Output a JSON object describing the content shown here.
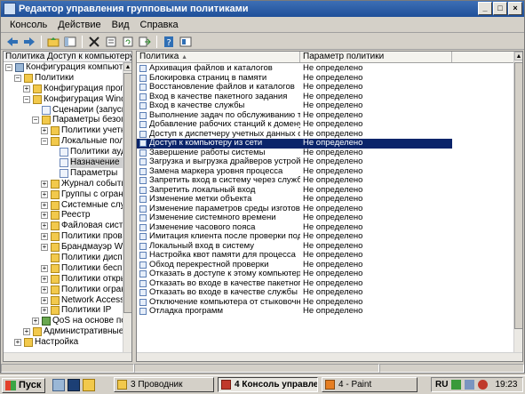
{
  "window": {
    "title": "Редактор управления групповыми политиками",
    "controls": [
      "_",
      "□",
      "×"
    ]
  },
  "menu": [
    "Консоль",
    "Действие",
    "Вид",
    "Справка"
  ],
  "toolbar": [
    "back-arrow-icon",
    "forward-arrow-icon",
    "up-folder-icon",
    "show-hide-tree-icon",
    "delete-icon",
    "properties-icon",
    "refresh-icon",
    "export-icon",
    "help-icon",
    "help-topic-icon"
  ],
  "tree": {
    "header": "Политика Доступ к компьютеру",
    "items": [
      {
        "depth": 0,
        "expander": "−",
        "icon": "pc",
        "label": "Конфигурация компьютера"
      },
      {
        "depth": 1,
        "expander": "−",
        "icon": "folder",
        "label": "Политики"
      },
      {
        "depth": 2,
        "expander": "+",
        "icon": "folder",
        "label": "Конфигурация программ"
      },
      {
        "depth": 2,
        "expander": "−",
        "icon": "folder",
        "label": "Конфигурация Windows"
      },
      {
        "depth": 3,
        "expander": "",
        "icon": "doc",
        "label": "Сценарии (запуск)"
      },
      {
        "depth": 3,
        "expander": "−",
        "icon": "folder",
        "label": "Параметры безопасности"
      },
      {
        "depth": 4,
        "expander": "+",
        "icon": "folder",
        "label": "Политики учетных"
      },
      {
        "depth": 4,
        "expander": "−",
        "icon": "folder",
        "label": "Локальные политики"
      },
      {
        "depth": 5,
        "expander": "",
        "icon": "doc",
        "label": "Политики аудита"
      },
      {
        "depth": 5,
        "expander": "",
        "icon": "doc",
        "label": "Назначение прав",
        "selected": true
      },
      {
        "depth": 5,
        "expander": "",
        "icon": "doc",
        "label": "Параметры"
      },
      {
        "depth": 4,
        "expander": "+",
        "icon": "folder",
        "label": "Журнал событий"
      },
      {
        "depth": 4,
        "expander": "+",
        "icon": "folder",
        "label": "Группы с ограниченным"
      },
      {
        "depth": 4,
        "expander": "+",
        "icon": "folder",
        "label": "Системные службы"
      },
      {
        "depth": 4,
        "expander": "+",
        "icon": "folder",
        "label": "Реестр"
      },
      {
        "depth": 4,
        "expander": "+",
        "icon": "folder",
        "label": "Файловая система"
      },
      {
        "depth": 4,
        "expander": "+",
        "icon": "folder",
        "label": "Политики проводной"
      },
      {
        "depth": 4,
        "expander": "+",
        "icon": "folder",
        "label": "Брандмауэр Windows"
      },
      {
        "depth": 4,
        "expander": "",
        "icon": "folder",
        "label": "Политики диспетчера"
      },
      {
        "depth": 4,
        "expander": "+",
        "icon": "folder",
        "label": "Политики беспроводной"
      },
      {
        "depth": 4,
        "expander": "+",
        "icon": "folder",
        "label": "Политики открытого"
      },
      {
        "depth": 4,
        "expander": "+",
        "icon": "folder",
        "label": "Политики ограниченного"
      },
      {
        "depth": 4,
        "expander": "+",
        "icon": "folder",
        "label": "Network Access"
      },
      {
        "depth": 4,
        "expander": "+",
        "icon": "folder",
        "label": "Политики IP"
      },
      {
        "depth": 3,
        "expander": "+",
        "icon": "chart",
        "label": "QoS на основе политики"
      },
      {
        "depth": 2,
        "expander": "+",
        "icon": "folder",
        "label": "Административные шаблоны"
      },
      {
        "depth": 1,
        "expander": "+",
        "icon": "folder",
        "label": "Настройка"
      }
    ]
  },
  "list": {
    "columns": [
      "Политика",
      "Параметр политики"
    ],
    "rows": [
      {
        "policy": "Архивация файлов и каталогов",
        "value": "Не определено"
      },
      {
        "policy": "Блокировка страниц в памяти",
        "value": "Не определено"
      },
      {
        "policy": "Восстановление файлов и каталогов",
        "value": "Не определено"
      },
      {
        "policy": "Вход в качестве пакетного задания",
        "value": "Не определено"
      },
      {
        "policy": "Вход в качестве службы",
        "value": "Не определено"
      },
      {
        "policy": "Выполнение задач по обслуживанию томов",
        "value": "Не определено"
      },
      {
        "policy": "Добавление рабочих станций к домену",
        "value": "Не определено"
      },
      {
        "policy": "Доступ к диспетчеру учетных данных от...",
        "value": "Не определено"
      },
      {
        "policy": "Доступ к компьютеру из сети",
        "value": "Не определено",
        "selected": true
      },
      {
        "policy": "Завершение работы системы",
        "value": "Не определено"
      },
      {
        "policy": "Загрузка и выгрузка драйверов устройств",
        "value": "Не определено"
      },
      {
        "policy": "Замена маркера уровня процесса",
        "value": "Не определено"
      },
      {
        "policy": "Запретить вход в систему через службу ...",
        "value": "Не определено"
      },
      {
        "policy": "Запретить локальный вход",
        "value": "Не определено"
      },
      {
        "policy": "Изменение метки объекта",
        "value": "Не определено"
      },
      {
        "policy": "Изменение параметров среды изготовителя",
        "value": "Не определено"
      },
      {
        "policy": "Изменение системного времени",
        "value": "Не определено"
      },
      {
        "policy": "Изменение часового пояса",
        "value": "Не определено"
      },
      {
        "policy": "Имитация клиента после проверки подли...",
        "value": "Не определено"
      },
      {
        "policy": "Локальный вход в систему",
        "value": "Не определено"
      },
      {
        "policy": "Настройка квот памяти для процесса",
        "value": "Не определено"
      },
      {
        "policy": "Обход перекрестной проверки",
        "value": "Не определено"
      },
      {
        "policy": "Отказать в доступе к этому компьютеру ...",
        "value": "Не определено"
      },
      {
        "policy": "Отказать во входе в качестве пакетного...",
        "value": "Не определено"
      },
      {
        "policy": "Отказать во входе в качестве службы",
        "value": "Не определено"
      },
      {
        "policy": "Отключение компьютера от стыковочно...",
        "value": "Не определено"
      },
      {
        "policy": "Отладка программ",
        "value": "Не определено"
      }
    ]
  },
  "taskbar": {
    "start": "Пуск",
    "buttons": [
      {
        "label": "3 Проводник",
        "active": false
      },
      {
        "label": "4 Консоль управле...",
        "active": true
      },
      {
        "label": "4 - Paint",
        "active": false
      }
    ],
    "lang": "RU",
    "time": "19:23"
  },
  "colors": {
    "title_bar": "#1f4f99",
    "selection": "#0a246a",
    "chrome": "#d4d0c8"
  }
}
